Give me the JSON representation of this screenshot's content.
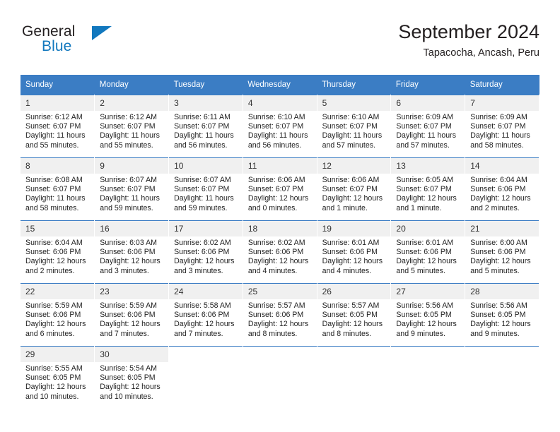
{
  "brand": {
    "name_part1": "General",
    "name_part2": "Blue",
    "triangle_color": "#1278be"
  },
  "header": {
    "title": "September 2024",
    "location": "Tapacocha, Ancash, Peru"
  },
  "theme": {
    "header_blue": "#3b7dc4",
    "daynum_band": "#f0f0f0",
    "text": "#222222"
  },
  "weekdays": [
    "Sunday",
    "Monday",
    "Tuesday",
    "Wednesday",
    "Thursday",
    "Friday",
    "Saturday"
  ],
  "weeks": [
    [
      {
        "day": "1",
        "sunrise": "Sunrise: 6:12 AM",
        "sunset": "Sunset: 6:07 PM",
        "daylight1": "Daylight: 11 hours",
        "daylight2": "and 55 minutes."
      },
      {
        "day": "2",
        "sunrise": "Sunrise: 6:12 AM",
        "sunset": "Sunset: 6:07 PM",
        "daylight1": "Daylight: 11 hours",
        "daylight2": "and 55 minutes."
      },
      {
        "day": "3",
        "sunrise": "Sunrise: 6:11 AM",
        "sunset": "Sunset: 6:07 PM",
        "daylight1": "Daylight: 11 hours",
        "daylight2": "and 56 minutes."
      },
      {
        "day": "4",
        "sunrise": "Sunrise: 6:10 AM",
        "sunset": "Sunset: 6:07 PM",
        "daylight1": "Daylight: 11 hours",
        "daylight2": "and 56 minutes."
      },
      {
        "day": "5",
        "sunrise": "Sunrise: 6:10 AM",
        "sunset": "Sunset: 6:07 PM",
        "daylight1": "Daylight: 11 hours",
        "daylight2": "and 57 minutes."
      },
      {
        "day": "6",
        "sunrise": "Sunrise: 6:09 AM",
        "sunset": "Sunset: 6:07 PM",
        "daylight1": "Daylight: 11 hours",
        "daylight2": "and 57 minutes."
      },
      {
        "day": "7",
        "sunrise": "Sunrise: 6:09 AM",
        "sunset": "Sunset: 6:07 PM",
        "daylight1": "Daylight: 11 hours",
        "daylight2": "and 58 minutes."
      }
    ],
    [
      {
        "day": "8",
        "sunrise": "Sunrise: 6:08 AM",
        "sunset": "Sunset: 6:07 PM",
        "daylight1": "Daylight: 11 hours",
        "daylight2": "and 58 minutes."
      },
      {
        "day": "9",
        "sunrise": "Sunrise: 6:07 AM",
        "sunset": "Sunset: 6:07 PM",
        "daylight1": "Daylight: 11 hours",
        "daylight2": "and 59 minutes."
      },
      {
        "day": "10",
        "sunrise": "Sunrise: 6:07 AM",
        "sunset": "Sunset: 6:07 PM",
        "daylight1": "Daylight: 11 hours",
        "daylight2": "and 59 minutes."
      },
      {
        "day": "11",
        "sunrise": "Sunrise: 6:06 AM",
        "sunset": "Sunset: 6:07 PM",
        "daylight1": "Daylight: 12 hours",
        "daylight2": "and 0 minutes."
      },
      {
        "day": "12",
        "sunrise": "Sunrise: 6:06 AM",
        "sunset": "Sunset: 6:07 PM",
        "daylight1": "Daylight: 12 hours",
        "daylight2": "and 1 minute."
      },
      {
        "day": "13",
        "sunrise": "Sunrise: 6:05 AM",
        "sunset": "Sunset: 6:07 PM",
        "daylight1": "Daylight: 12 hours",
        "daylight2": "and 1 minute."
      },
      {
        "day": "14",
        "sunrise": "Sunrise: 6:04 AM",
        "sunset": "Sunset: 6:06 PM",
        "daylight1": "Daylight: 12 hours",
        "daylight2": "and 2 minutes."
      }
    ],
    [
      {
        "day": "15",
        "sunrise": "Sunrise: 6:04 AM",
        "sunset": "Sunset: 6:06 PM",
        "daylight1": "Daylight: 12 hours",
        "daylight2": "and 2 minutes."
      },
      {
        "day": "16",
        "sunrise": "Sunrise: 6:03 AM",
        "sunset": "Sunset: 6:06 PM",
        "daylight1": "Daylight: 12 hours",
        "daylight2": "and 3 minutes."
      },
      {
        "day": "17",
        "sunrise": "Sunrise: 6:02 AM",
        "sunset": "Sunset: 6:06 PM",
        "daylight1": "Daylight: 12 hours",
        "daylight2": "and 3 minutes."
      },
      {
        "day": "18",
        "sunrise": "Sunrise: 6:02 AM",
        "sunset": "Sunset: 6:06 PM",
        "daylight1": "Daylight: 12 hours",
        "daylight2": "and 4 minutes."
      },
      {
        "day": "19",
        "sunrise": "Sunrise: 6:01 AM",
        "sunset": "Sunset: 6:06 PM",
        "daylight1": "Daylight: 12 hours",
        "daylight2": "and 4 minutes."
      },
      {
        "day": "20",
        "sunrise": "Sunrise: 6:01 AM",
        "sunset": "Sunset: 6:06 PM",
        "daylight1": "Daylight: 12 hours",
        "daylight2": "and 5 minutes."
      },
      {
        "day": "21",
        "sunrise": "Sunrise: 6:00 AM",
        "sunset": "Sunset: 6:06 PM",
        "daylight1": "Daylight: 12 hours",
        "daylight2": "and 5 minutes."
      }
    ],
    [
      {
        "day": "22",
        "sunrise": "Sunrise: 5:59 AM",
        "sunset": "Sunset: 6:06 PM",
        "daylight1": "Daylight: 12 hours",
        "daylight2": "and 6 minutes."
      },
      {
        "day": "23",
        "sunrise": "Sunrise: 5:59 AM",
        "sunset": "Sunset: 6:06 PM",
        "daylight1": "Daylight: 12 hours",
        "daylight2": "and 7 minutes."
      },
      {
        "day": "24",
        "sunrise": "Sunrise: 5:58 AM",
        "sunset": "Sunset: 6:06 PM",
        "daylight1": "Daylight: 12 hours",
        "daylight2": "and 7 minutes."
      },
      {
        "day": "25",
        "sunrise": "Sunrise: 5:57 AM",
        "sunset": "Sunset: 6:06 PM",
        "daylight1": "Daylight: 12 hours",
        "daylight2": "and 8 minutes."
      },
      {
        "day": "26",
        "sunrise": "Sunrise: 5:57 AM",
        "sunset": "Sunset: 6:05 PM",
        "daylight1": "Daylight: 12 hours",
        "daylight2": "and 8 minutes."
      },
      {
        "day": "27",
        "sunrise": "Sunrise: 5:56 AM",
        "sunset": "Sunset: 6:05 PM",
        "daylight1": "Daylight: 12 hours",
        "daylight2": "and 9 minutes."
      },
      {
        "day": "28",
        "sunrise": "Sunrise: 5:56 AM",
        "sunset": "Sunset: 6:05 PM",
        "daylight1": "Daylight: 12 hours",
        "daylight2": "and 9 minutes."
      }
    ],
    [
      {
        "day": "29",
        "sunrise": "Sunrise: 5:55 AM",
        "sunset": "Sunset: 6:05 PM",
        "daylight1": "Daylight: 12 hours",
        "daylight2": "and 10 minutes."
      },
      {
        "day": "30",
        "sunrise": "Sunrise: 5:54 AM",
        "sunset": "Sunset: 6:05 PM",
        "daylight1": "Daylight: 12 hours",
        "daylight2": "and 10 minutes."
      },
      {
        "day": "",
        "sunrise": "",
        "sunset": "",
        "daylight1": "",
        "daylight2": ""
      },
      {
        "day": "",
        "sunrise": "",
        "sunset": "",
        "daylight1": "",
        "daylight2": ""
      },
      {
        "day": "",
        "sunrise": "",
        "sunset": "",
        "daylight1": "",
        "daylight2": ""
      },
      {
        "day": "",
        "sunrise": "",
        "sunset": "",
        "daylight1": "",
        "daylight2": ""
      },
      {
        "day": "",
        "sunrise": "",
        "sunset": "",
        "daylight1": "",
        "daylight2": ""
      }
    ]
  ]
}
